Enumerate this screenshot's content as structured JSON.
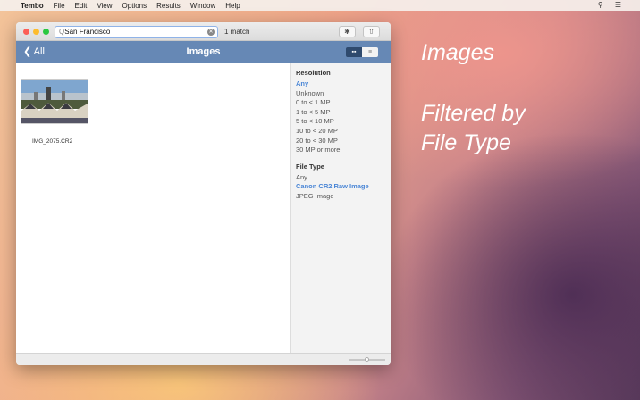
{
  "menubar": {
    "apple": "",
    "app": "Tembo",
    "items": [
      "File",
      "Edit",
      "View",
      "Options",
      "Results",
      "Window",
      "Help"
    ],
    "right_icons": [
      "search-icon",
      "list-icon"
    ]
  },
  "window": {
    "search": {
      "value": "San Francisco",
      "icon": "magnifier-icon"
    },
    "match_count": "1 match",
    "toolbar": {
      "settings_icon": "gear-icon",
      "share_icon": "share-icon"
    },
    "nav": {
      "back_label": "All",
      "title": "Images",
      "view_modes": [
        "grid",
        "list"
      ],
      "active_view": "grid"
    },
    "results": [
      {
        "filename": "IMG_2075.CR2"
      }
    ],
    "sidebar": {
      "sections": [
        {
          "title": "Resolution",
          "items": [
            "Any",
            "Unknown",
            "0 to < 1 MP",
            "1 to < 5 MP",
            "5 to < 10 MP",
            "10 to < 20 MP",
            "20 to < 30 MP",
            "30 MP or more"
          ],
          "selected": "Any"
        },
        {
          "title": "File Type",
          "items": [
            "Any",
            "Canon CR2 Raw Image",
            "JPEG Image"
          ],
          "selected": "Canon CR2 Raw Image"
        }
      ]
    },
    "colors": {
      "nav": "#6688b5",
      "selected": "#4a86d6"
    }
  },
  "promo": {
    "line1": "Images",
    "line2": "Filtered by",
    "line3": "File Type"
  }
}
